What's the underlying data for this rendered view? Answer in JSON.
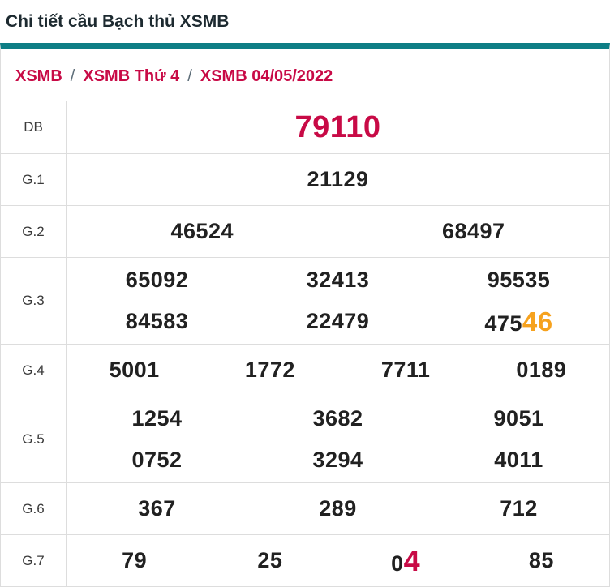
{
  "header": {
    "title": "Chi tiết cầu Bạch thủ XSMB"
  },
  "breadcrumb": {
    "separator": "/",
    "items": [
      "XSMB",
      "XSMB Thứ 4",
      "XSMB 04/05/2022"
    ]
  },
  "colors": {
    "accent_teal": "#0e7e85",
    "crimson": "#c80a46",
    "orange": "#f6a21e",
    "text": "#212121",
    "border": "#dddddd"
  },
  "prizes": [
    {
      "label": "DB",
      "lines": [
        [
          [
            {
              "t": "79110",
              "hl": "db"
            }
          ]
        ]
      ]
    },
    {
      "label": "G.1",
      "lines": [
        [
          [
            {
              "t": "21129"
            }
          ]
        ]
      ]
    },
    {
      "label": "G.2",
      "lines": [
        [
          [
            {
              "t": "46524"
            }
          ],
          [
            {
              "t": "68497"
            }
          ]
        ]
      ]
    },
    {
      "label": "G.3",
      "lines": [
        [
          [
            {
              "t": "65092"
            }
          ],
          [
            {
              "t": "32413"
            }
          ],
          [
            {
              "t": "95535"
            }
          ]
        ],
        [
          [
            {
              "t": "84583"
            }
          ],
          [
            {
              "t": "22479"
            }
          ],
          [
            {
              "t": "475"
            },
            {
              "t": "46",
              "hl": "orange"
            }
          ]
        ]
      ]
    },
    {
      "label": "G.4",
      "lines": [
        [
          [
            {
              "t": "5001"
            }
          ],
          [
            {
              "t": "1772"
            }
          ],
          [
            {
              "t": "7711"
            }
          ],
          [
            {
              "t": "0189"
            }
          ]
        ]
      ]
    },
    {
      "label": "G.5",
      "lines": [
        [
          [
            {
              "t": "1254"
            }
          ],
          [
            {
              "t": "3682"
            }
          ],
          [
            {
              "t": "9051"
            }
          ]
        ],
        [
          [
            {
              "t": "0752"
            }
          ],
          [
            {
              "t": "3294"
            }
          ],
          [
            {
              "t": "4011"
            }
          ]
        ]
      ]
    },
    {
      "label": "G.6",
      "lines": [
        [
          [
            {
              "t": "367"
            }
          ],
          [
            {
              "t": "289"
            }
          ],
          [
            {
              "t": "712"
            }
          ]
        ]
      ]
    },
    {
      "label": "G.7",
      "lines": [
        [
          [
            {
              "t": "79"
            }
          ],
          [
            {
              "t": "25"
            }
          ],
          [
            {
              "t": "0"
            },
            {
              "t": "4",
              "hl": "red"
            }
          ],
          [
            {
              "t": "85"
            }
          ]
        ]
      ]
    }
  ]
}
